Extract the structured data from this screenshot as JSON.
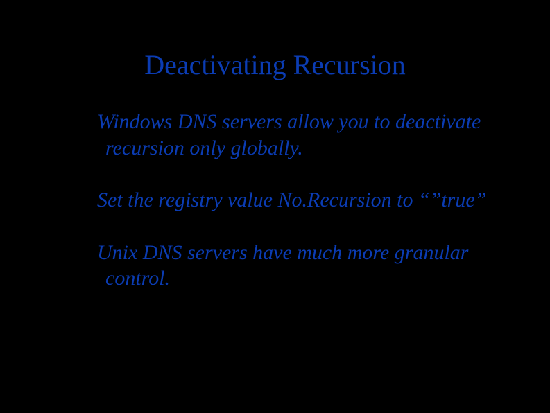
{
  "slide": {
    "title": "Deactivating Recursion",
    "paragraphs": [
      "Windows DNS servers allow you to deactivate recursion only globally.",
      "Set the registry value No.Recursion to “”true”",
      "Unix DNS servers have much more granular control."
    ]
  }
}
